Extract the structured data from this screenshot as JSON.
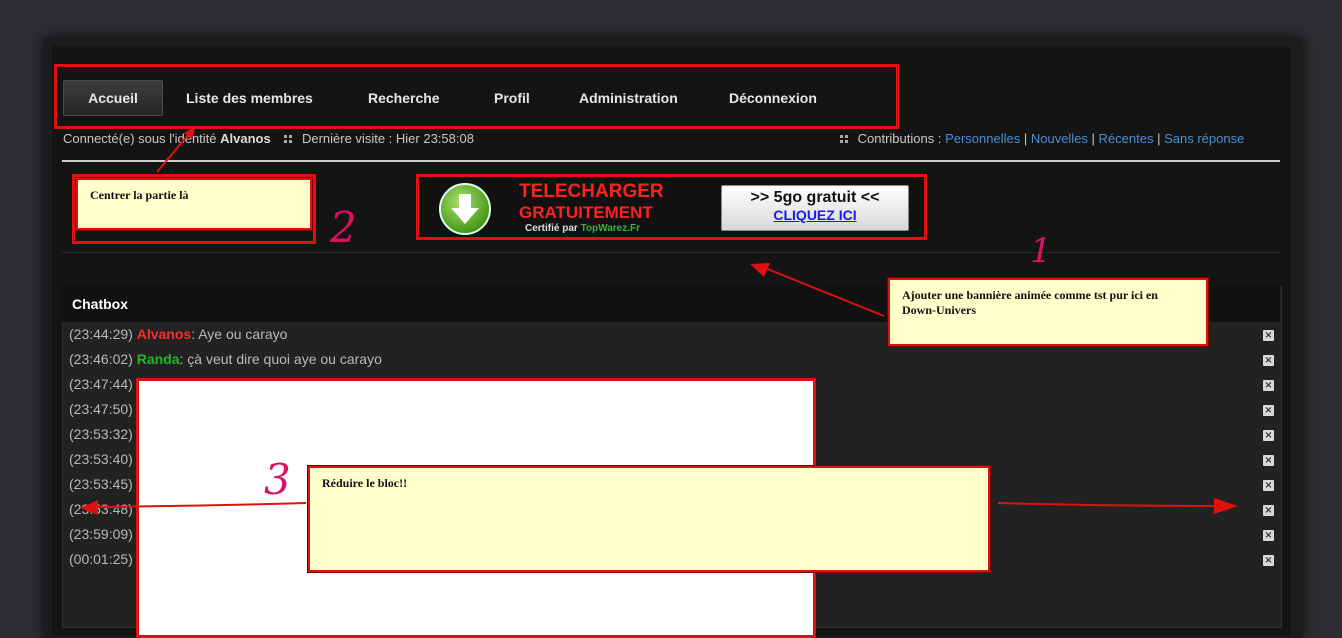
{
  "nav": {
    "items": [
      "Accueil",
      "Liste des membres",
      "Recherche",
      "Profil",
      "Administration",
      "Déconnexion"
    ]
  },
  "info": {
    "connected_prefix": "Connecté(e) sous l'identité",
    "username": "Alvanos",
    "last_visit": "Dernière visite : Hier 23:58:08",
    "contrib_label": "Contributions :",
    "contrib_links": [
      "Personnelles",
      "Nouvelles",
      "Récentes",
      "Sans réponse"
    ]
  },
  "banner": {
    "line1": "TELECHARGER",
    "line2": "GRATUITEMENT",
    "cert_prefix": "Certifié par",
    "cert_site": "TopWarez.Fr",
    "button_line1": ">> 5go gratuit <<",
    "button_line2": "CLIQUEZ ICI"
  },
  "chatbox": {
    "title": "Chatbox",
    "messages": [
      {
        "time": "(23:44:29)",
        "user": "Alvanos",
        "user_color": "#ff2a2a",
        "text": ": Aye ou carayo"
      },
      {
        "time": "(23:46:02)",
        "user": "Randa",
        "user_color": "#22b822",
        "text": ": çà veut dire quoi aye ou carayo"
      },
      {
        "time": "(23:47:44)",
        "user": "",
        "user_color": "",
        "text": ""
      },
      {
        "time": "(23:47:50)",
        "user": "",
        "user_color": "",
        "text": ""
      },
      {
        "time": "(23:53:32)",
        "user": "",
        "user_color": "",
        "text": ""
      },
      {
        "time": "(23:53:40)",
        "user": "",
        "user_color": "",
        "text": ""
      },
      {
        "time": "(23:53:45)",
        "user": "",
        "user_color": "",
        "text": ""
      },
      {
        "time": "(23:53:48)",
        "user": "",
        "user_color": "",
        "text": ""
      },
      {
        "time": "(23:59:09)",
        "user": "",
        "user_color": "",
        "text": ""
      },
      {
        "time": "(00:01:25)",
        "user": "",
        "user_color": "",
        "text": ""
      }
    ]
  },
  "annotations": {
    "note2": "Centrer la partie là",
    "note1": "Ajouter une bannière animée comme tst pur ici en Down-Univers",
    "note3": "Réduire le bloc!!",
    "num1": "1",
    "num2": "2",
    "num3": "3"
  },
  "colors": {
    "annotation_red": "#e01010",
    "note_bg": "#ffffcc",
    "link": "#4a8fd4"
  }
}
